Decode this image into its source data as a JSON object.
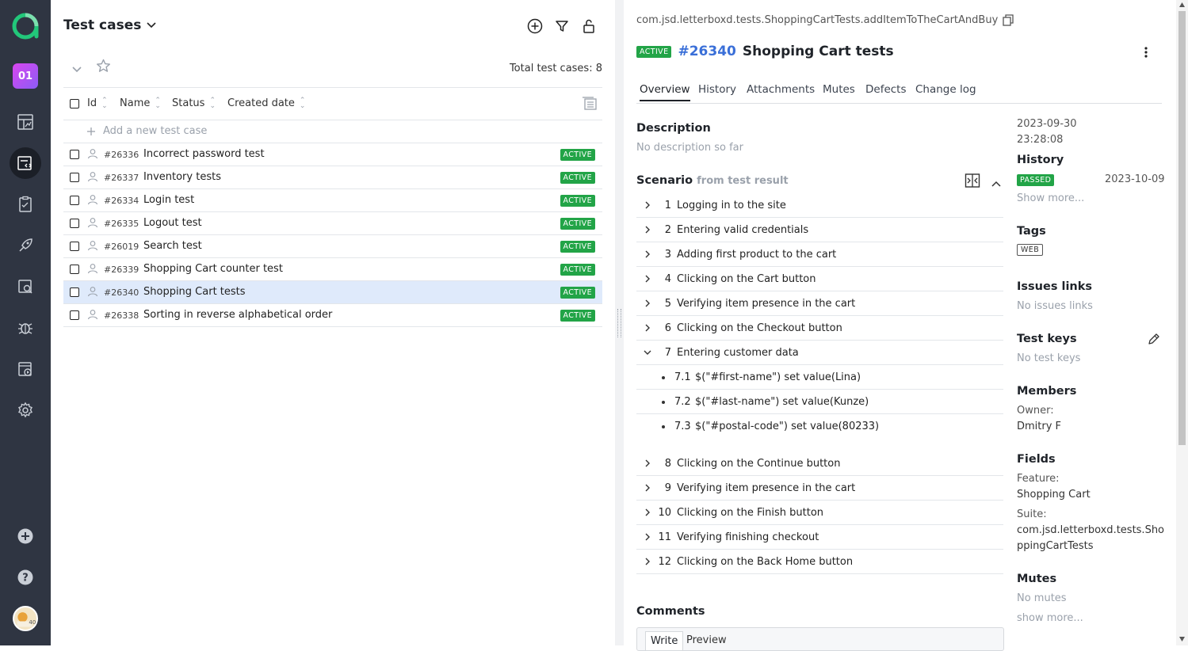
{
  "sidebar": {
    "project_label": "01"
  },
  "left_panel": {
    "title": "Test cases",
    "total_label": "Total test cases: 8",
    "columns": [
      "Id",
      "Name",
      "Status",
      "Created date"
    ],
    "add_placeholder": "Add a new test case",
    "rows": [
      {
        "id": "#26336",
        "name": "Incorrect password test",
        "status": "ACTIVE"
      },
      {
        "id": "#26337",
        "name": "Inventory tests",
        "status": "ACTIVE"
      },
      {
        "id": "#26334",
        "name": "Login test",
        "status": "ACTIVE"
      },
      {
        "id": "#26335",
        "name": "Logout test",
        "status": "ACTIVE"
      },
      {
        "id": "#26019",
        "name": "Search test",
        "status": "ACTIVE"
      },
      {
        "id": "#26339",
        "name": "Shopping Cart counter test",
        "status": "ACTIVE"
      },
      {
        "id": "#26340",
        "name": "Shopping Cart tests",
        "status": "ACTIVE"
      },
      {
        "id": "#26338",
        "name": "Sorting in reverse alphabetical order",
        "status": "ACTIVE"
      }
    ]
  },
  "detail": {
    "path": "com.jsd.letterboxd.tests.ShoppingCartTests.addItemToTheCartAndBuy",
    "status": "ACTIVE",
    "number": "#26340",
    "title": "Shopping Cart tests",
    "tabs": [
      "Overview",
      "History",
      "Attachments",
      "Mutes",
      "Defects",
      "Change log"
    ],
    "description_title": "Description",
    "description": "No description so far",
    "scenario_title": "Scenario",
    "scenario_source": "from test result",
    "steps_a": [
      {
        "n": "1",
        "text": "Logging in to the site"
      },
      {
        "n": "2",
        "text": "Entering valid credentials"
      },
      {
        "n": "3",
        "text": "Adding first product to the cart"
      },
      {
        "n": "4",
        "text": "Clicking on the Cart button"
      },
      {
        "n": "5",
        "text": "Verifying item presence in the cart"
      },
      {
        "n": "6",
        "text": "Clicking on the Checkout button"
      },
      {
        "n": "7",
        "text": "Entering customer data"
      }
    ],
    "substeps": [
      {
        "n": "7.1",
        "text": "$(\"#first-name\") set value(Lina)"
      },
      {
        "n": "7.2",
        "text": "$(\"#last-name\") set value(Kunze)"
      },
      {
        "n": "7.3",
        "text": "$(\"#postal-code\") set value(80233)"
      }
    ],
    "steps_b": [
      {
        "n": "8",
        "text": "Clicking on the Continue button"
      },
      {
        "n": "9",
        "text": "Verifying item presence in the cart"
      },
      {
        "n": "10",
        "text": "Clicking on the Finish button"
      },
      {
        "n": "11",
        "text": "Verifying finishing checkout"
      },
      {
        "n": "12",
        "text": "Clicking on the Back Home button"
      }
    ],
    "comments_title": "Comments",
    "comment_tabs": {
      "write": "Write",
      "preview": "Preview"
    }
  },
  "meta": {
    "created_date": "2023-09-30",
    "created_time": "23:28:08",
    "history_title": "History",
    "history_status": "PASSED",
    "history_date": "2023-10-09",
    "show_more": "Show more...",
    "tags_title": "Tags",
    "tag": "WEB",
    "issues_title": "Issues links",
    "issues_empty": "No issues links",
    "keys_title": "Test keys",
    "keys_empty": "No test keys",
    "members_title": "Members",
    "owner_label": "Owner:",
    "owner": "Dmitry F",
    "fields_title": "Fields",
    "feature_label": "Feature:",
    "feature": "Shopping Cart",
    "suite_label": "Suite:",
    "suite_line1": "com.jsd.letterboxd.tests.Sho",
    "suite_line2": "ppingCartTests",
    "mutes_title": "Mutes",
    "mutes_empty": "No mutes",
    "show_more2": "show more..."
  },
  "colors": {
    "sidebar": "#2f3542",
    "active_badge": "#22a447",
    "link": "#3a6fd8",
    "selected_row": "#dfeafb",
    "logo": "#22c77a"
  }
}
